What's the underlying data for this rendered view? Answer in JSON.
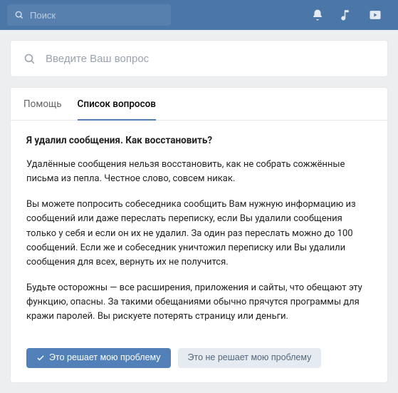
{
  "topbar": {
    "search_placeholder": "Поиск"
  },
  "help_search": {
    "placeholder": "Введите Ваш вопрос"
  },
  "tabs": {
    "help": "Помощь",
    "questions": "Список вопросов"
  },
  "article": {
    "title": "Я удалил сообщения. Как восстановить?",
    "p1": "Удалённые сообщения нельзя восстановить, как не собрать сожжённые письма из пепла. Честное слово, совсем никак.",
    "p2": "Вы можете попросить собеседника сообщить Вам нужную информацию из сообщений или даже переслать переписку, если Вы удалили сообщения только у себя и если он их не удалил. За один раз переслать можно до 100 сообщений. Если же и собеседник уничтожил переписку или Вы удалили сообщения для всех, вернуть их не получится.",
    "p3": "Будьте осторожны — все расширения, приложения и сайты, что обещают эту функцию, опасны. За такими обещаниями обычно прячутся программы для кражи паролей. Вы рискуете потерять страницу или деньги."
  },
  "actions": {
    "solves": "Это решает мою проблему",
    "not_solves": "Это не решает мою проблему"
  }
}
